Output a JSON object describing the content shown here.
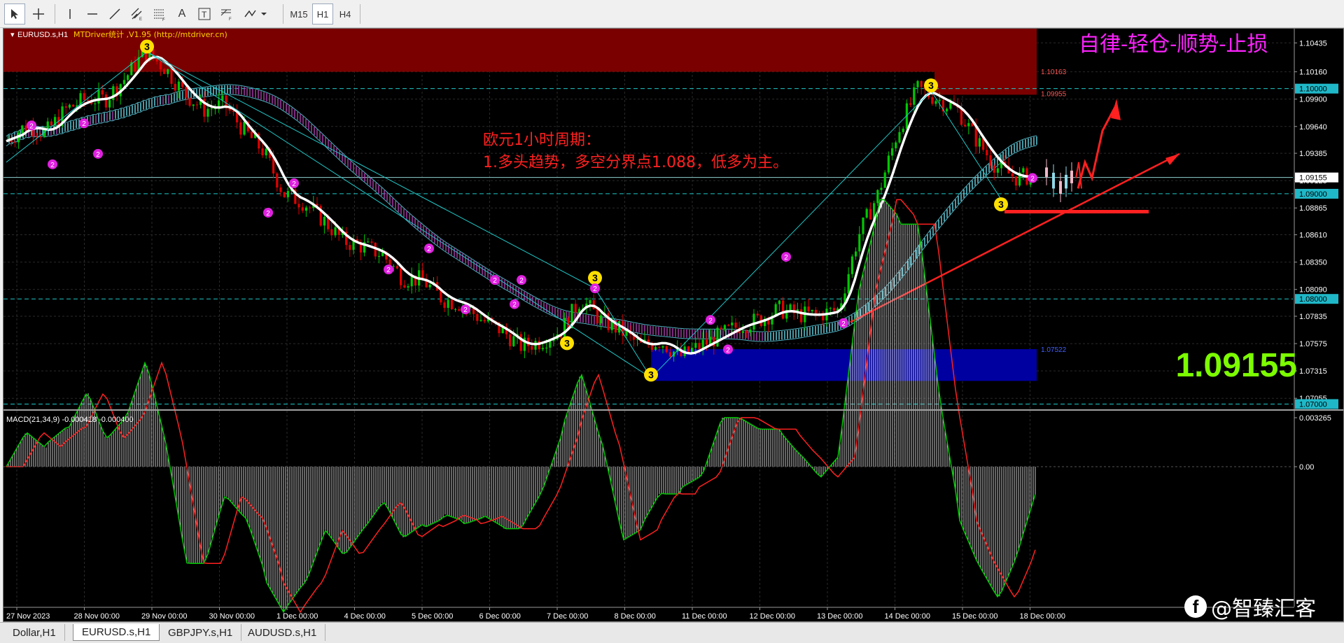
{
  "toolbar": {
    "timeframes": [
      "M15",
      "H1",
      "H4"
    ],
    "active_timeframe": "H1",
    "text_tool": "A",
    "label_tool": "T"
  },
  "chart_header": {
    "symbol": "EURUSD.s,H1",
    "indicator_label": "MTDriver统计 ,V1.95 (http://mtdriver.cn)"
  },
  "slogan": "自律-轻仓-顺势-止损",
  "analysis": {
    "line1": "欧元1小时周期：",
    "line2": "1.多头趋势，多空分界点1.088，低多为主。"
  },
  "current_price": "1.09155",
  "macd_label": "MACD(21,34,9) -0.000418 -0.000400",
  "chart_data": [
    {
      "type": "line",
      "title": "",
      "symbol": "EURUSD.s",
      "timeframe": "H1",
      "x_labels": [
        "27 Nov 2023",
        "28 Nov 00:00",
        "29 Nov 00:00",
        "30 Nov 00:00",
        "1 Dec 00:00",
        "4 Dec 00:00",
        "5 Dec 00:00",
        "6 Dec 00:00",
        "7 Dec 00:00",
        "8 Dec 00:00",
        "11 Dec 00:00",
        "12 Dec 00:00",
        "13 Dec 00:00",
        "14 Dec 00:00",
        "15 Dec 00:00",
        "18 Dec 00:00"
      ],
      "y_tick_labels": [
        "1.10435",
        "1.10160",
        "1.09900",
        "1.09640",
        "1.09385",
        "1.09125",
        "1.08865",
        "1.08610",
        "1.08350",
        "1.08090",
        "1.07835",
        "1.07575",
        "1.07315",
        "1.07055"
      ],
      "ylim": [
        1.0695,
        1.1057
      ],
      "highlighted_levels": [
        "1.10000",
        "1.09155",
        "1.09000",
        "1.08000",
        "1.07000"
      ],
      "zone_labels": [
        "1.10163",
        "1.09955",
        "1.07522"
      ],
      "series": [
        {
          "name": "",
          "values": [
            1.095,
            1.0965,
            1.0958,
            1.098,
            1.099,
            1.099,
            1.101,
            1.1035,
            1.102,
            1.0995,
            1.098,
            1.0985,
            1.096,
            1.094,
            1.09,
            1.0892,
            1.0875,
            1.0855,
            1.085,
            1.0842,
            1.082,
            1.0818,
            1.08,
            1.0795,
            1.078,
            1.077,
            1.0755,
            1.076,
            1.077,
            1.08,
            1.078,
            1.077,
            1.0755,
            1.076,
            1.0745,
            1.0755,
            1.0765,
            1.0775,
            1.078,
            1.079,
            1.0785,
            1.0785,
            1.079,
            1.086,
            1.09,
            1.096,
            1.1,
            1.099,
            1.098,
            1.095,
            1.0925,
            1.0915,
            1.0918
          ]
        }
      ]
    },
    {
      "type": "bar",
      "title": "MACD(21,34,9)",
      "y_tick_labels": [
        "0.003265",
        "0.00"
      ],
      "last_values": [
        -0.000418,
        -0.0004
      ]
    }
  ],
  "tabs": [
    "Dollar,H1",
    "EURUSD.s,H1",
    "GBPJPY.s,H1",
    "AUDUSD.s,H1"
  ],
  "active_tab": "EURUSD.s,H1",
  "watermark": "@智臻汇客",
  "colors": {
    "bull_candle": "#00c800",
    "bear_candle": "#e00000",
    "ma_line": "#ffffff",
    "resistance_zone": "#7a0000",
    "support_zone": "#0000a0",
    "slogan": "#ff22ff",
    "analysis_text": "#ff2020",
    "price_big": "#7cfc00"
  }
}
